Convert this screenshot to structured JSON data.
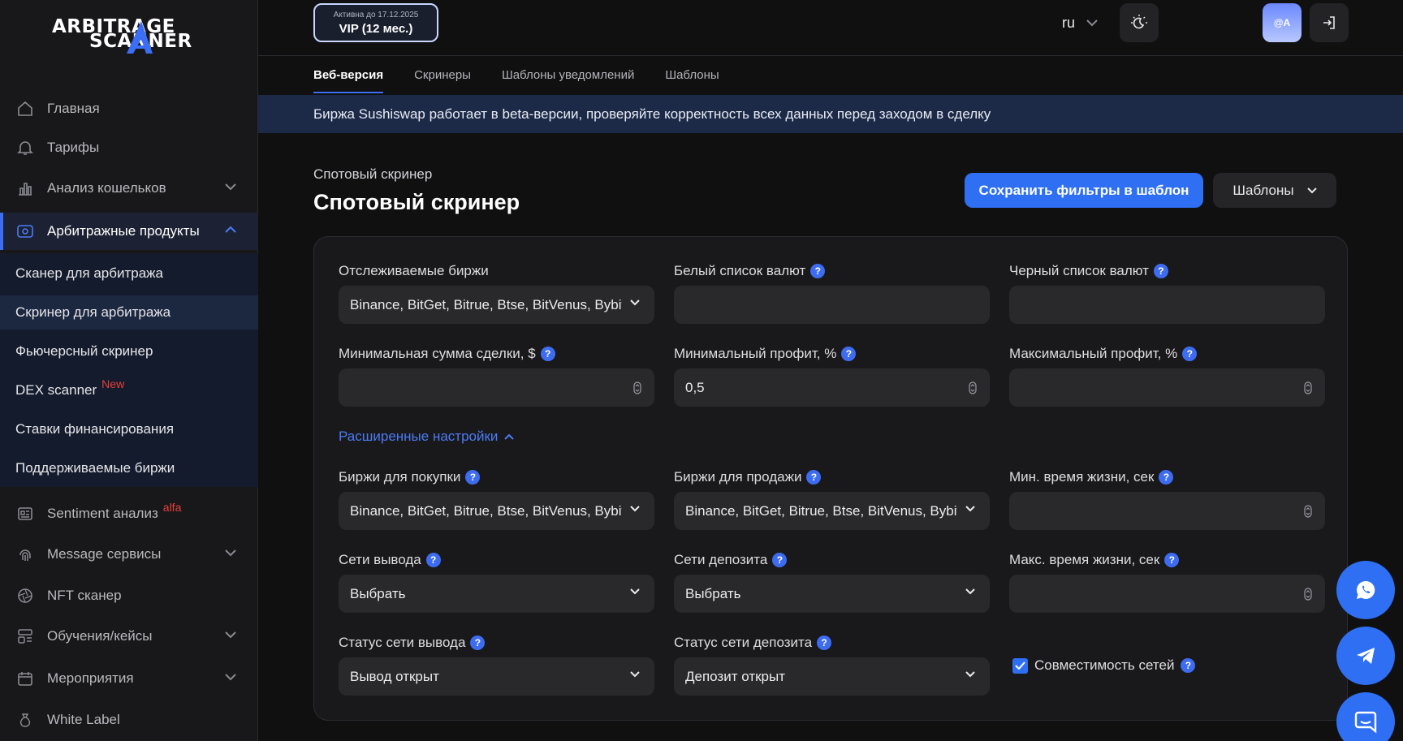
{
  "logo": {
    "line1": "ARBITRAGE",
    "line2": "SCANNER"
  },
  "sidebar": {
    "items": [
      {
        "label": "Главная"
      },
      {
        "label": "Тарифы"
      },
      {
        "label": "Анализ кошельков"
      },
      {
        "label": "Арбитражные продукты"
      },
      {
        "label": "Sentiment анализ",
        "badge": "alfa"
      },
      {
        "label": "Message сервисы"
      },
      {
        "label": "NFT сканер"
      },
      {
        "label": "Обучения/кейсы"
      },
      {
        "label": "Мероприятия"
      },
      {
        "label": "White Label"
      }
    ],
    "submenu": [
      {
        "label": "Сканер для арбитража"
      },
      {
        "label": "Скринер для арбитража"
      },
      {
        "label": "Фьючерсный скринер"
      },
      {
        "label": "DEX scanner",
        "badge": "New"
      },
      {
        "label": "Ставки финансирования"
      },
      {
        "label": "Поддерживаемые биржи"
      }
    ]
  },
  "header": {
    "vip_small": "Активна до 17.12.2025",
    "vip_big": "VIP (12 мес.)",
    "lang": "ru",
    "avatar": "@A"
  },
  "tabs": [
    "Веб-версия",
    "Скринеры",
    "Шаблоны уведомлений",
    "Шаблоны"
  ],
  "banner": "Биржа Sushiswap работает в beta-версии, проверяйте корректность всех данных перед заходом в сделку",
  "main": {
    "breadcrumb": "Спотовый скринер",
    "title": "Спотовый скринер",
    "save_button": "Сохранить фильтры в шаблон",
    "templates_button": "Шаблоны"
  },
  "form": {
    "tracked_exchanges": {
      "label": "Отслеживаемые биржи",
      "value": "Binance, BitGet, Bitrue, Btse, BitVenus, Bybit"
    },
    "whitelist": {
      "label": "Белый список валют",
      "value": ""
    },
    "blacklist": {
      "label": "Черный список валют",
      "value": ""
    },
    "min_deal": {
      "label": "Минимальная сумма сделки, $",
      "value": ""
    },
    "min_profit": {
      "label": "Минимальный профит, %",
      "value": "0,5"
    },
    "max_profit": {
      "label": "Максимальный профит, %",
      "value": ""
    },
    "advanced": "Расширенные настройки",
    "buy_exchanges": {
      "label": "Биржи для покупки",
      "value": "Binance, BitGet, Bitrue, Btse, BitVenus, Bybit"
    },
    "sell_exchanges": {
      "label": "Биржи для продажи",
      "value": "Binance, BitGet, Bitrue, Btse, BitVenus, Bybit"
    },
    "min_lifetime": {
      "label": "Мин. время жизни, сек",
      "value": ""
    },
    "withdraw_networks": {
      "label": "Сети вывода",
      "value": "Выбрать"
    },
    "deposit_networks": {
      "label": "Сети депозита",
      "value": "Выбрать"
    },
    "max_lifetime": {
      "label": "Макс. время жизни, сек",
      "value": ""
    },
    "withdraw_status": {
      "label": "Статус сети вывода",
      "value": "Вывод открыт"
    },
    "deposit_status": {
      "label": "Статус сети депозита",
      "value": "Депозит открыт"
    },
    "network_compat": {
      "label": "Совместимость сетей",
      "checked": true
    }
  },
  "colors": {
    "accent": "#2e6ff3",
    "background": "#101011",
    "sidebar": "#18181a",
    "banner": "#1c2a48"
  }
}
